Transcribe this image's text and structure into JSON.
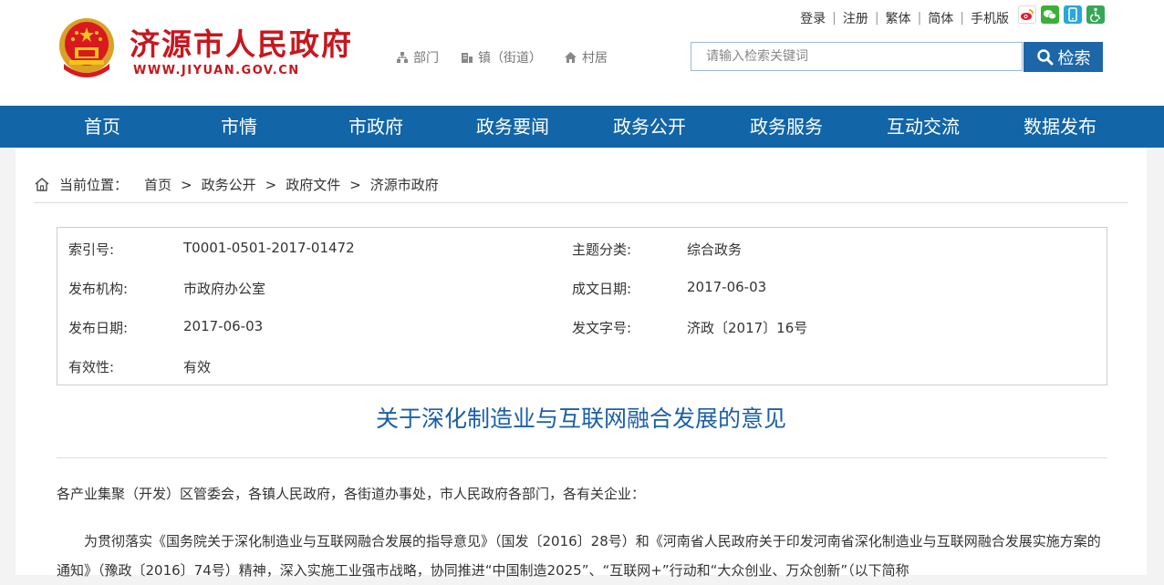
{
  "header": {
    "site_name": "济源市人民政府",
    "site_url": "WWW.JIYUAN.GOV.CN",
    "sublinks": [
      {
        "label": "部门",
        "icon": "org-chart-icon"
      },
      {
        "label": "镇（街道）",
        "icon": "building-icon"
      },
      {
        "label": "村居",
        "icon": "home-icon"
      }
    ],
    "toplinks": [
      "登录",
      "注册",
      "繁体",
      "简体",
      "手机版"
    ],
    "social": [
      "weibo-icon",
      "wechat-icon",
      "mobile-icon",
      "accessibility-icon"
    ],
    "search": {
      "placeholder": "请输入检索关键词",
      "button_label": "检索"
    }
  },
  "nav": [
    "首页",
    "市情",
    "市政府",
    "政务要闻",
    "政务公开",
    "政务服务",
    "互动交流",
    "数据发布"
  ],
  "breadcrumb": {
    "label": "当前位置：",
    "items": [
      "首页",
      "政务公开",
      "政府文件",
      "济源市政府"
    ],
    "separator": ">"
  },
  "meta": {
    "index_label": "索引号:",
    "index_value": "T0001-0501-2017-01472",
    "topic_label": "主题分类:",
    "topic_value": "综合政务",
    "org_label": "发布机构:",
    "org_value": "市政府办公室",
    "written_label": "成文日期:",
    "written_value": "2017-06-03",
    "publish_label": "发布日期:",
    "publish_value": "2017-06-03",
    "docno_label": "发文字号:",
    "docno_value": "济政〔2017〕16号",
    "valid_label": "有效性:",
    "valid_value": "有效"
  },
  "article": {
    "title": "关于深化制造业与互联网融合发展的意见",
    "salutation": "各产业集聚（开发）区管委会，各镇人民政府，各街道办事处，市人民政府各部门，各有关企业：",
    "paragraph1": "为贯彻落实《国务院关于深化制造业与互联网融合发展的指导意见》（国发〔2016〕28号）和《河南省人民政府关于印发河南省深化制造业与互联网融合发展实施方案的通知》（豫政〔2016〕74号）精神，深入实施工业强市战略，协同推进“中国制造2025”、“互联网+”行动和“大众创业、万众创新”（以下简称"
  },
  "colors": {
    "brand_red": "#c8161d",
    "nav_blue": "#1265a7",
    "title_blue": "#1a5fa8",
    "search_blue": "#1d67a8"
  }
}
